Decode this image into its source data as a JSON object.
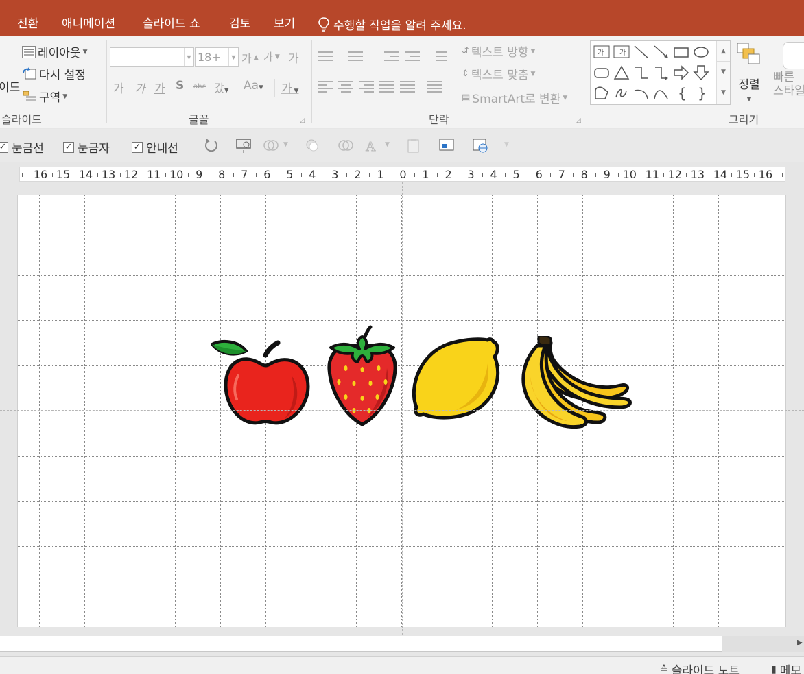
{
  "window": {
    "title_fragment": "",
    "accent_color": "#b7472a"
  },
  "tabs": [
    {
      "label": "전환"
    },
    {
      "label": "애니메이션"
    },
    {
      "label": "슬라이드 쇼"
    },
    {
      "label": "검토"
    },
    {
      "label": "보기"
    }
  ],
  "tell_me": {
    "icon": "lightbulb-icon",
    "text": "수행할 작업을 알려 주세요."
  },
  "ribbon": {
    "slides_group": {
      "label": "슬라이드",
      "cut_label": "이드",
      "layout": "레이아웃",
      "reset": "다시 설정",
      "section": "구역"
    },
    "font_group": {
      "label": "글꼴",
      "font_name": "",
      "font_size": "18+",
      "grow": "가",
      "shrink": "가",
      "clear": "가",
      "bold": "가",
      "italic": "가",
      "underline": "가",
      "shadow": "S",
      "strike": "abc",
      "spacing": "갔",
      "case": "Aa",
      "color": "가"
    },
    "paragraph_group": {
      "label": "단락",
      "text_direction": "텍스트 방향",
      "align_text": "텍스트 맞춤",
      "smartart": "SmartArt로 변환"
    },
    "drawing_group": {
      "label": "그리기",
      "arrange": "정렬",
      "quick_styles": "빠른 스타일"
    }
  },
  "view_toolbar": {
    "checkboxes": [
      {
        "label": "눈금선",
        "checked": true
      },
      {
        "label": "눈금자",
        "checked": true
      },
      {
        "label": "안내선",
        "checked": true
      }
    ]
  },
  "ruler": {
    "labels": [
      "16",
      "15",
      "14",
      "13",
      "12",
      "11",
      "10",
      "9",
      "8",
      "7",
      "6",
      "5",
      "4",
      "3",
      "2",
      "1",
      "0",
      "1",
      "2",
      "3",
      "4",
      "5",
      "6",
      "7",
      "8",
      "9",
      "10",
      "11",
      "12",
      "13",
      "14",
      "15",
      "16"
    ]
  },
  "slide": {
    "fruits": [
      {
        "name": "apple",
        "color": "#e9241d"
      },
      {
        "name": "strawberry",
        "color": "#e42a2a"
      },
      {
        "name": "lemon",
        "color": "#f9d31a"
      },
      {
        "name": "banana",
        "color": "#f8c51b"
      }
    ]
  },
  "statusbar": {
    "notes": "슬라이드 노트",
    "comments": "메모"
  }
}
